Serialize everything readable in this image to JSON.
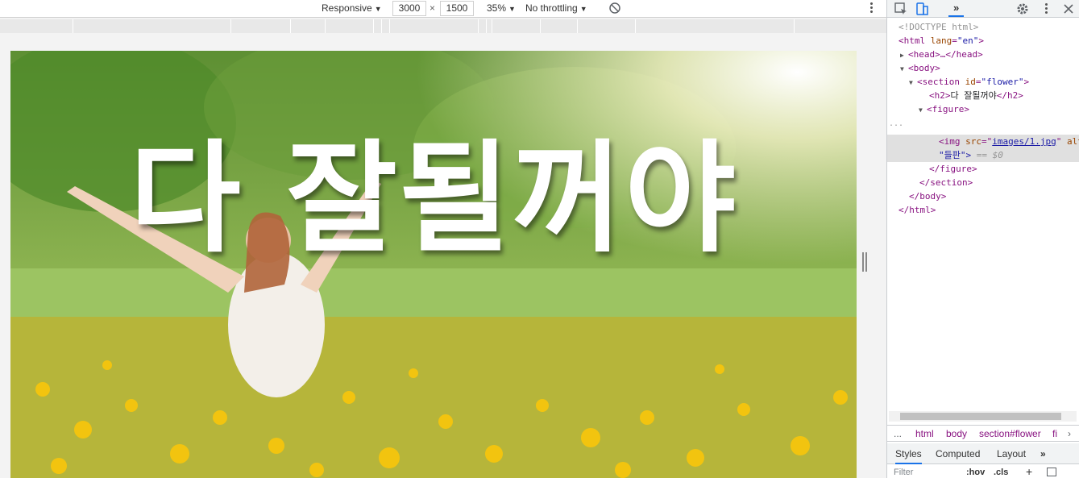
{
  "device_toolbar": {
    "device_label": "Responsive",
    "width_value": "3000",
    "times_symbol": "×",
    "height_value": "1500",
    "zoom_label": "35%",
    "throttle_label": "No throttling"
  },
  "page": {
    "heading": "다 잘될꺼야"
  },
  "devtools": {
    "tab_chevron": "»",
    "dom": {
      "doctype": "<!DOCTYPE html>",
      "html_open_tag": "html",
      "html_lang_attr": "lang",
      "html_lang_val": "\"en\"",
      "head_collapsed": "<head>…</head>",
      "body_open": "<body>",
      "section_tag": "section",
      "section_id_attr": "id",
      "section_id_val": "\"flower\"",
      "h2_open": "<h2>",
      "h2_text": "다 잘될꺼야",
      "h2_close": "</h2>",
      "figure_open": "<figure>",
      "img_tag": "img",
      "img_src_attr": "src",
      "img_src_val": "images/1.jpg",
      "img_alt_attr": "alt",
      "img_alt_cont": "들판\">",
      "selected_marker": "== $0",
      "figure_close": "</figure>",
      "section_close": "</section>",
      "body_close": "</body>",
      "html_close": "</html>",
      "row_dots": "..."
    },
    "breadcrumbs": [
      "...",
      "html",
      "body",
      "section#flower",
      "fi"
    ],
    "style_tabs": {
      "styles": "Styles",
      "computed": "Computed",
      "layout": "Layout",
      "more": "»"
    },
    "filter": {
      "placeholder": "Filter",
      "hov": ":hov",
      "cls": ".cls",
      "plus": "+"
    }
  },
  "colors": {
    "accent": "#1a73e8",
    "tag": "#881280",
    "attr": "#994500",
    "attr_value": "#1a1aa6"
  }
}
